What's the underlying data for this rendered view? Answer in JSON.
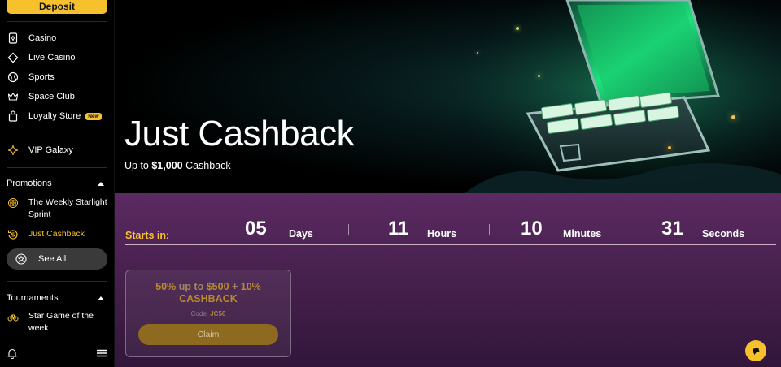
{
  "sidebar": {
    "deposit_label": "Deposit",
    "nav": [
      {
        "label": "Casino",
        "icon": "card-icon"
      },
      {
        "label": "Live Casino",
        "icon": "diamond-card-icon"
      },
      {
        "label": "Sports",
        "icon": "ball-icon"
      },
      {
        "label": "Space Club",
        "icon": "crown-icon"
      },
      {
        "label": "Loyalty Store",
        "icon": "bag-icon",
        "badge": "New"
      }
    ],
    "vip_label": "VIP Galaxy",
    "promotions": {
      "heading": "Promotions",
      "items": [
        {
          "label": "The Weekly Starlight Sprint",
          "icon": "spiral-icon"
        },
        {
          "label": "Just Cashback",
          "icon": "cashback-icon",
          "active": true
        }
      ],
      "see_all": "See All"
    },
    "tournaments": {
      "heading": "Tournaments",
      "items": [
        {
          "label": "Star Game of the week",
          "icon": "bike-icon"
        }
      ]
    }
  },
  "hero": {
    "title": "Just Cashback",
    "subtitle_prefix": "Up to ",
    "subtitle_amount": "$1,000",
    "subtitle_suffix": " Cashback"
  },
  "countdown": {
    "label": "Starts in:",
    "days": "05",
    "days_label": "Days",
    "hours": "11",
    "hours_label": "Hours",
    "minutes": "10",
    "minutes_label": "Minutes",
    "seconds": "31",
    "seconds_label": "Seconds"
  },
  "offer": {
    "pct": "50%",
    "upto": " up to ",
    "amount": "$500",
    "plus": " + ",
    "bonus": "10%",
    "line2": "CASHBACK",
    "code_label": "Code: ",
    "code": "JC50",
    "claim_label": "Claim"
  },
  "colors": {
    "accent": "#f7c12d",
    "sidebar_bg": "#000000",
    "promo_bg": "#4a2250"
  }
}
